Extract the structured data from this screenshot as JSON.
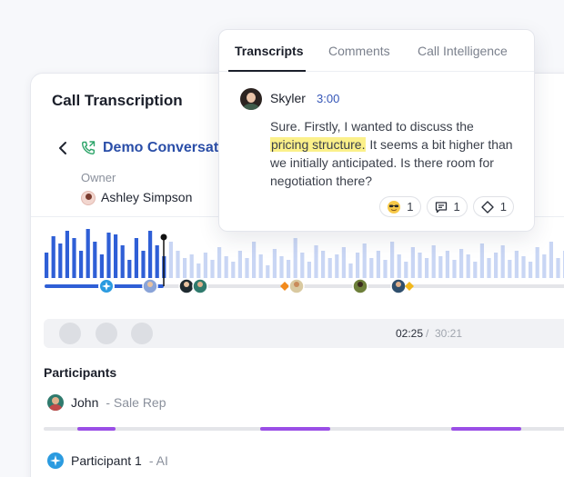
{
  "card": {
    "title": "Call Transcription",
    "call_name": "Demo Conversation",
    "owner_label": "Owner",
    "owner_name": "Ashley Simpson"
  },
  "player": {
    "current_time": "02:25",
    "separator": "/",
    "total_time": "30:21"
  },
  "participants": {
    "title": "Participants",
    "items": [
      {
        "name": "John",
        "role": "- Sale Rep"
      },
      {
        "name": "Participant 1",
        "role": "- AI"
      }
    ]
  },
  "popover": {
    "tabs": [
      {
        "label": "Transcripts",
        "active": true
      },
      {
        "label": "Comments",
        "active": false
      },
      {
        "label": "Call Intelligence",
        "active": false
      }
    ],
    "speaker": "Skyler",
    "time": "3:00",
    "message_before": "Sure. Firstly, I wanted to discuss the ",
    "message_highlight": "pricing structure.",
    "message_after": " It seems a bit higher than we initially anticipated. Is there room for negotiation there?",
    "reactions": [
      {
        "icon": "emoji-cool-icon",
        "count": "1"
      },
      {
        "icon": "comment-icon",
        "count": "1"
      },
      {
        "icon": "diamond-icon",
        "count": "1"
      }
    ]
  },
  "colors": {
    "accent_blue": "#2f5fd6",
    "light_blue": "#c9d6f4",
    "purple_segment": "#9a4ee6",
    "highlight": "#fbf08a"
  }
}
